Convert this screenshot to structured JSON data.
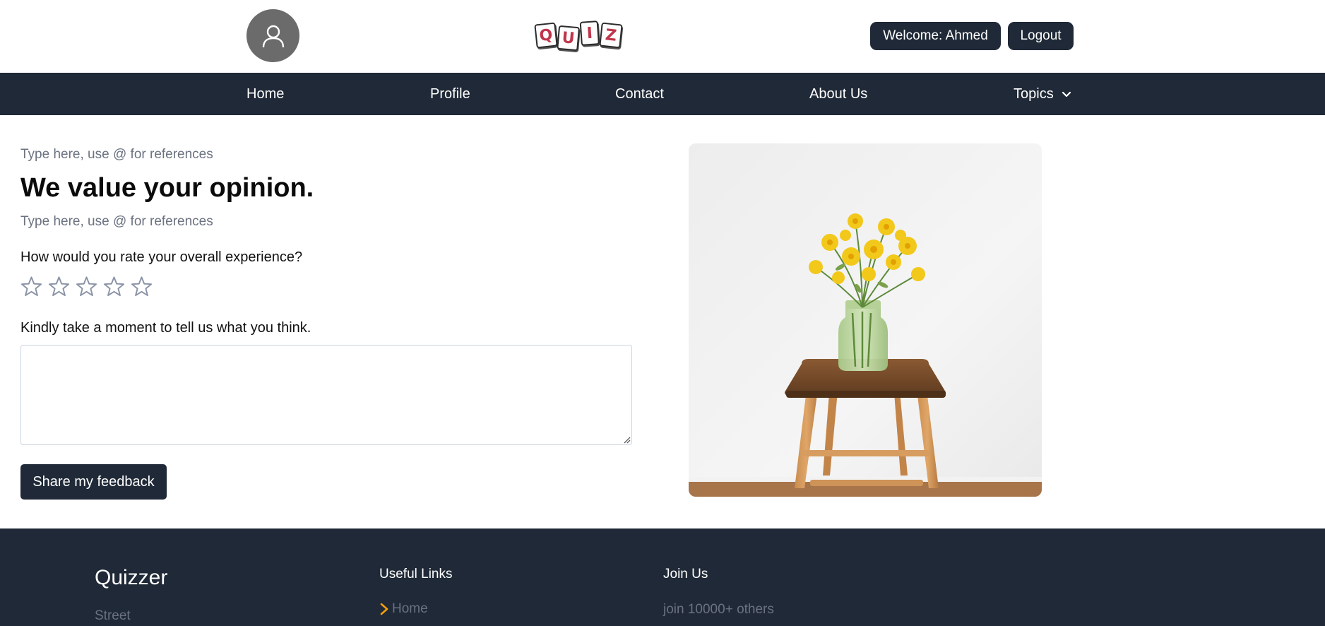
{
  "header": {
    "logo_letters": [
      "Q",
      "U",
      "I",
      "Z"
    ],
    "welcome_label": "Welcome: Ahmed",
    "logout_label": "Logout"
  },
  "nav": {
    "items": [
      {
        "label": "Home"
      },
      {
        "label": "Profile"
      },
      {
        "label": "Contact"
      },
      {
        "label": "About Us"
      },
      {
        "label": "Topics"
      }
    ]
  },
  "feedback": {
    "hint_top": "Type here, use @ for references",
    "title": "We value your opinion.",
    "hint_bottom": "Type here, use @ for references",
    "rating_question": "How would you rate your overall experience?",
    "rating": {
      "value": 0,
      "max": 5
    },
    "comment_prompt": "Kindly take a moment to tell us what you think.",
    "comment_value": "",
    "submit_label": "Share my feedback"
  },
  "footer": {
    "brand": "Quizzer",
    "address": "Street",
    "useful_links_title": "Useful Links",
    "links": [
      {
        "label": "Home"
      }
    ],
    "join_title": "Join Us",
    "join_text": "join 10000+ others"
  },
  "colors": {
    "dark": "#1f2937",
    "accent_arrow": "#f59e0b",
    "muted_text": "#6b7280",
    "logo_red": "#c0354a"
  },
  "icons": {
    "avatar": "user-icon",
    "topics": "chevron-down-icon",
    "star": "star-outline-icon",
    "footer_link": "chevron-right-icon"
  }
}
